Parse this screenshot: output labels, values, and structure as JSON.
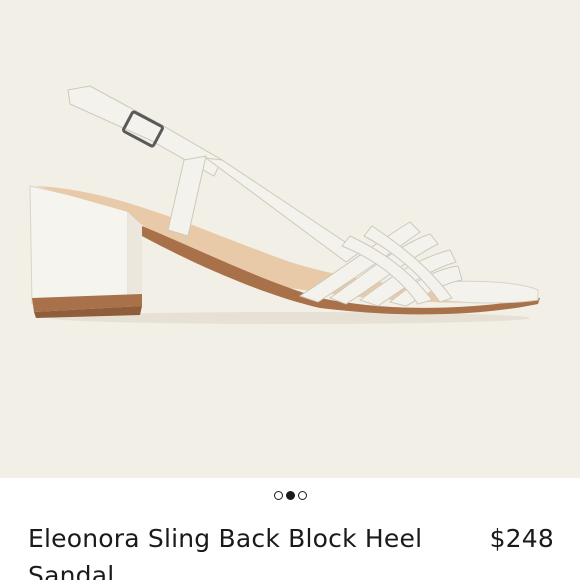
{
  "product": {
    "image_alt": "white strappy sling back block heel sandal",
    "title": "Eleonora Sling Back Block Heel Sandal",
    "price": "$248"
  },
  "carousel": {
    "count": 3,
    "active_index": 1
  },
  "colors": {
    "hero_background": "#f2efe6",
    "sandal": "#f4f2ec",
    "sole": "#b07a52",
    "text": "#1a1a1a"
  }
}
